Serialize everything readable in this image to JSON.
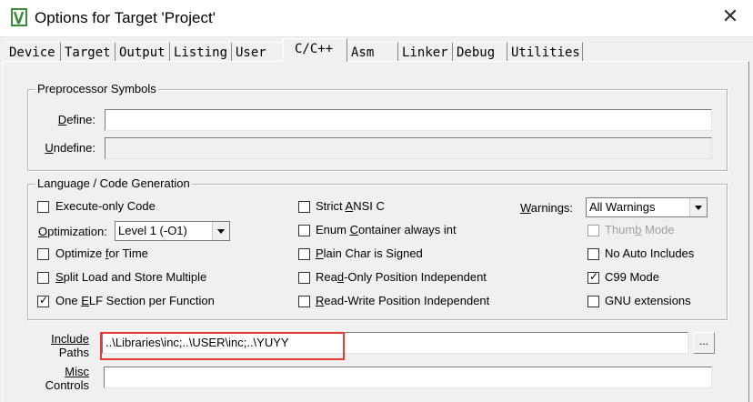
{
  "window": {
    "title": "Options for Target 'Project'",
    "close_glyph": "✕"
  },
  "tabs": [
    {
      "label": "Device"
    },
    {
      "label": "Target"
    },
    {
      "label": "Output"
    },
    {
      "label": "Listing"
    },
    {
      "label": "User"
    },
    {
      "label": "C/C++",
      "active": true
    },
    {
      "label": "Asm"
    },
    {
      "label": "Linker"
    },
    {
      "label": "Debug"
    },
    {
      "label": "Utilities"
    }
  ],
  "preprocessor": {
    "legend": "Preprocessor Symbols",
    "define_label_u": "D",
    "define_label_rest": "efine:",
    "define_value": "",
    "undefine_label_u": "U",
    "undefine_label_rest": "ndefine:",
    "undefine_value": ""
  },
  "language": {
    "legend": "Language / Code Generation",
    "execute_only": {
      "label": "Execute-only Code",
      "checked": false
    },
    "optimization": {
      "label_u": "O",
      "label_rest": "ptimization:",
      "value": "Level 1 (-O1)"
    },
    "optimize_time": {
      "pre": "Optimize ",
      "u": "f",
      "post": "or Time",
      "checked": false
    },
    "split_load": {
      "pre": "",
      "u": "S",
      "post": "plit Load and Store Multiple",
      "checked": false
    },
    "one_elf": {
      "pre": "One ",
      "u": "E",
      "post": "LF Section per Function",
      "checked": true
    },
    "strict_ansi": {
      "pre": "Strict ",
      "u": "A",
      "post": "NSI C",
      "checked": false
    },
    "enum_container": {
      "pre": "Enum ",
      "u": "C",
      "post": "ontainer always int",
      "checked": false
    },
    "plain_char": {
      "pre": "",
      "u": "P",
      "post": "lain Char is Signed",
      "checked": false
    },
    "ro_pi": {
      "pre": "Rea",
      "u": "d",
      "post": "-Only Position Independent",
      "checked": false
    },
    "rw_pi": {
      "pre": "",
      "u": "R",
      "post": "ead-Write Position Independent",
      "checked": false
    },
    "warnings": {
      "label_u": "W",
      "label_rest": "arnings:",
      "value": "All Warnings"
    },
    "thumb_mode": {
      "pre": "Thum",
      "u": "b",
      "post": " Mode",
      "checked": false,
      "disabled": true
    },
    "no_auto_includes": {
      "label": "No Auto Includes",
      "checked": false
    },
    "c99_mode": {
      "label": "C99 Mode",
      "checked": true
    },
    "gnu_ext": {
      "label": "GNU extensions",
      "checked": false
    }
  },
  "include": {
    "label_line1": "Include",
    "label_line2": "Paths",
    "value": "..\\Libraries\\inc;..\\USER\\inc;..\\YUYY",
    "browse": "..."
  },
  "misc": {
    "label_line1": "Misc",
    "label_line2": "Controls",
    "value": ""
  },
  "colors": {
    "highlight": "#e53935",
    "app_icon": "#3a8a3a"
  }
}
